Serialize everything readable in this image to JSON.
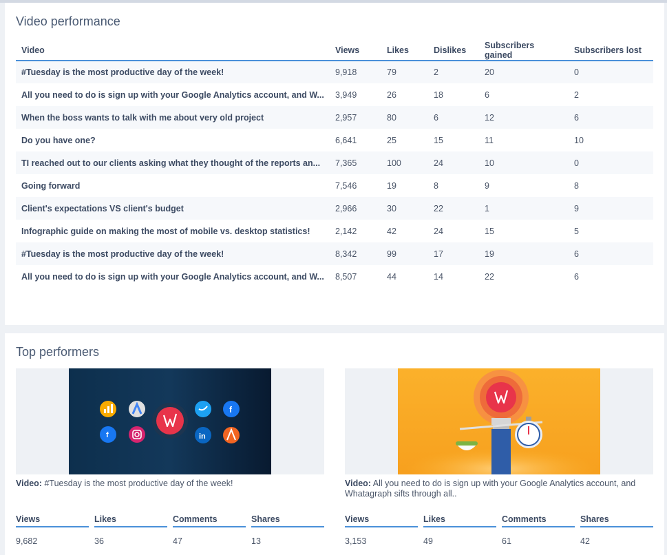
{
  "video_performance": {
    "title": "Video performance",
    "columns": [
      "Video",
      "Views",
      "Likes",
      "Dislikes",
      "Subscribers gained",
      "Subscribers lost"
    ],
    "rows": [
      [
        "#Tuesday is the most productive day of the week!",
        "9,918",
        "79",
        "2",
        "20",
        "0"
      ],
      [
        "All you need to do is sign up with your Google Analytics account, and W...",
        "3,949",
        "26",
        "18",
        "6",
        "2"
      ],
      [
        "When the boss wants to talk with me about very old project",
        "2,957",
        "80",
        "6",
        "12",
        "6"
      ],
      [
        "Do you have one?",
        "6,641",
        "25",
        "15",
        "11",
        "10"
      ],
      [
        "TI reached out to our clients asking what they thought of the reports an...",
        "7,365",
        "100",
        "24",
        "10",
        "0"
      ],
      [
        "Going forward",
        "7,546",
        "19",
        "8",
        "9",
        "8"
      ],
      [
        "Client's expectations VS client's budget",
        "2,966",
        "30",
        "22",
        "1",
        "9"
      ],
      [
        "Infographic guide on making the most of mobile vs. desktop statistics!",
        "2,142",
        "42",
        "24",
        "15",
        "5"
      ],
      [
        "#Tuesday is the most productive day of the week!",
        "8,342",
        "99",
        "17",
        "19",
        "6"
      ],
      [
        "All you need to do is sign up with your Google Analytics account, and W...",
        "8,507",
        "44",
        "14",
        "22",
        "6"
      ]
    ]
  },
  "top_performers": {
    "title": "Top performers",
    "items": [
      {
        "video_label": "Video:",
        "video_title": "#Tuesday is the most productive day of the week!",
        "stats": [
          {
            "label": "Views",
            "value": "9,682"
          },
          {
            "label": "Likes",
            "value": "36"
          },
          {
            "label": "Comments",
            "value": "47"
          },
          {
            "label": "Shares",
            "value": "13"
          }
        ]
      },
      {
        "video_label": "Video:",
        "video_title": "All you need to do is sign up with your Google Analytics account, and Whatagraph sifts through all..",
        "stats": [
          {
            "label": "Views",
            "value": "3,153"
          },
          {
            "label": "Likes",
            "value": "49"
          },
          {
            "label": "Comments",
            "value": "61"
          },
          {
            "label": "Shares",
            "value": "42"
          }
        ]
      }
    ]
  },
  "colors": {
    "accent": "#4a90d9",
    "thumb1_bg": "#0d2a45",
    "thumb2_bg": "#f9a825",
    "brand_red": "#e8344a"
  }
}
